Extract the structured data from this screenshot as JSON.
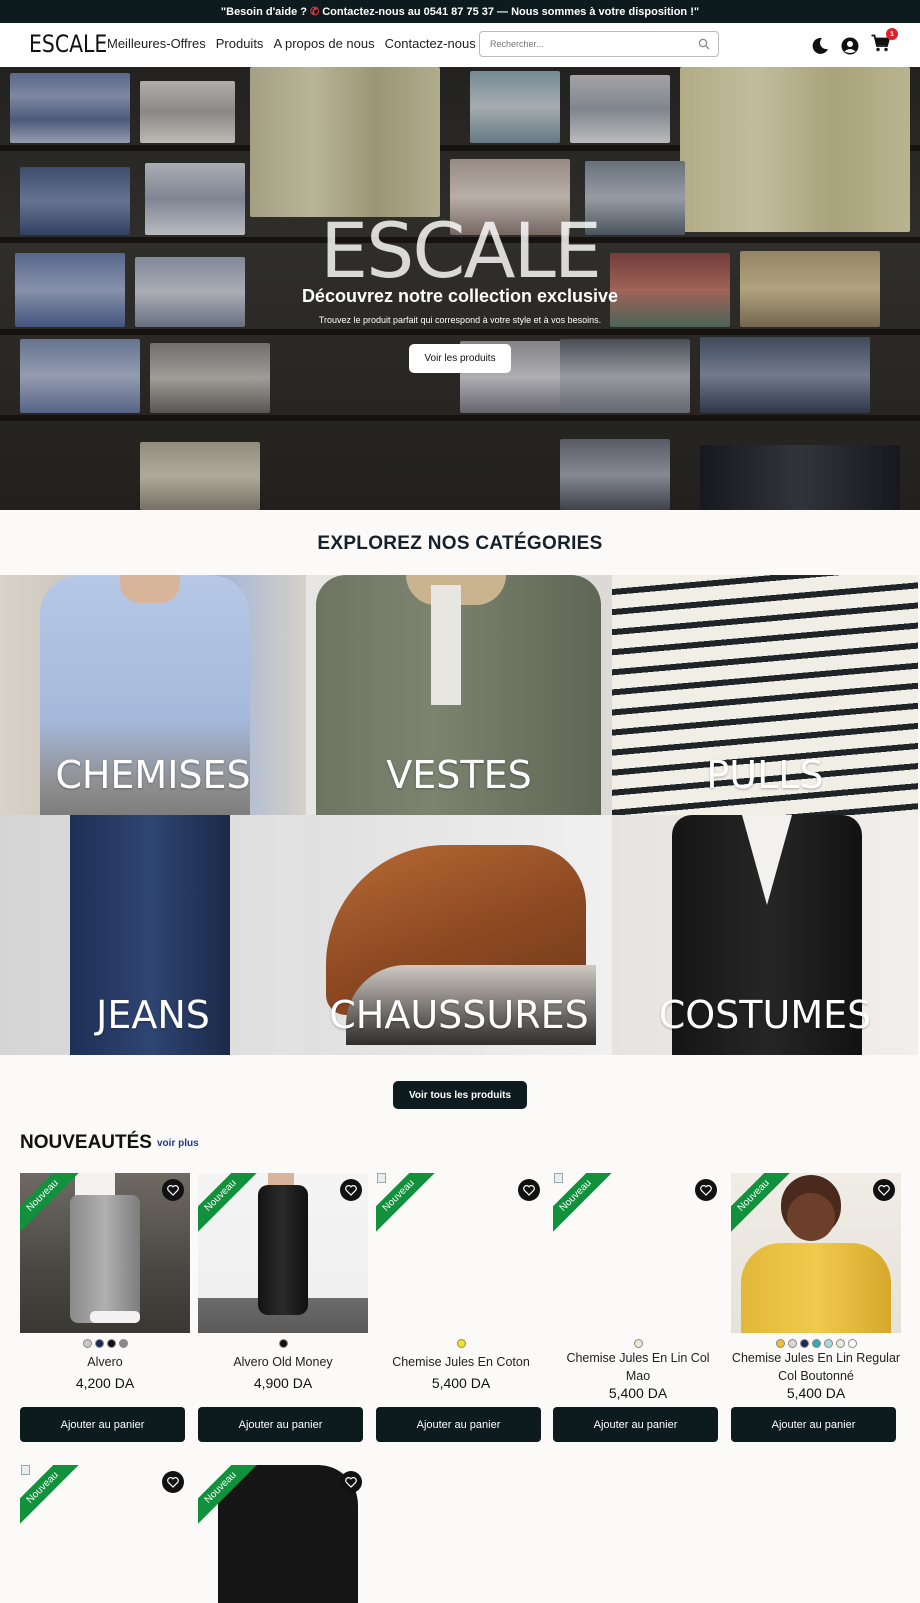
{
  "announcement": {
    "before": "\"Besoin d'aide ?",
    "after": "Contactez-nous au 0541 87 75 37 — Nous sommes à votre disposition !\""
  },
  "header": {
    "logo": "ESCALE",
    "nav": [
      "Meilleures-Offres",
      "Produits",
      "A propos de nous",
      "Contactez-nous"
    ],
    "search_placeholder": "Rechercher...",
    "cart_count": "1"
  },
  "hero": {
    "title": "ESCALE",
    "subtitle": "Découvrez notre collection exclusive",
    "text": "Trouvez le produit parfait qui correspond à votre style et à vos besoins.",
    "button": "Voir les produits"
  },
  "categories": {
    "heading": "EXPLOREZ NOS CATÉGORIES",
    "items": [
      "CHEMISES",
      "VESTES",
      "PULLS",
      "JEANS",
      "CHAUSSURES",
      "COSTUMES"
    ],
    "all_button": "Voir tous les produits"
  },
  "new_arrivals": {
    "heading": "NOUVEAUTÉS",
    "see_more": "voir plus",
    "badge": "Nouveau",
    "add_label": "Ajouter au panier",
    "products": [
      {
        "name": "Alvero",
        "price": "4,200 DA",
        "colors": [
          "#c8c8c8",
          "#1c2a55",
          "#111111",
          "#8a8a8a"
        ]
      },
      {
        "name": "Alvero Old Money",
        "price": "4,900 DA",
        "colors": [
          "#111111"
        ]
      },
      {
        "name": "Chemise Jules En Coton",
        "price": "5,400 DA",
        "colors": [
          "#f2e21a"
        ]
      },
      {
        "name": "Chemise Jules En Lin Col Mao",
        "price": "5,400 DA",
        "colors": [
          "#ece6d2"
        ]
      },
      {
        "name": "Chemise Jules En Lin Regular Col Boutonné",
        "price": "5,400 DA",
        "colors": [
          "#f0c030",
          "#d8d8d8",
          "#1c2a55",
          "#3aa8b0",
          "#a8d8e0",
          "#eee8d8",
          "#ffffff"
        ]
      }
    ]
  },
  "colors": {
    "dark": "#0d1b1e",
    "badge_green": "#12913d",
    "cart_badge": "#e0202a",
    "link_blue": "#1d3a8a"
  }
}
